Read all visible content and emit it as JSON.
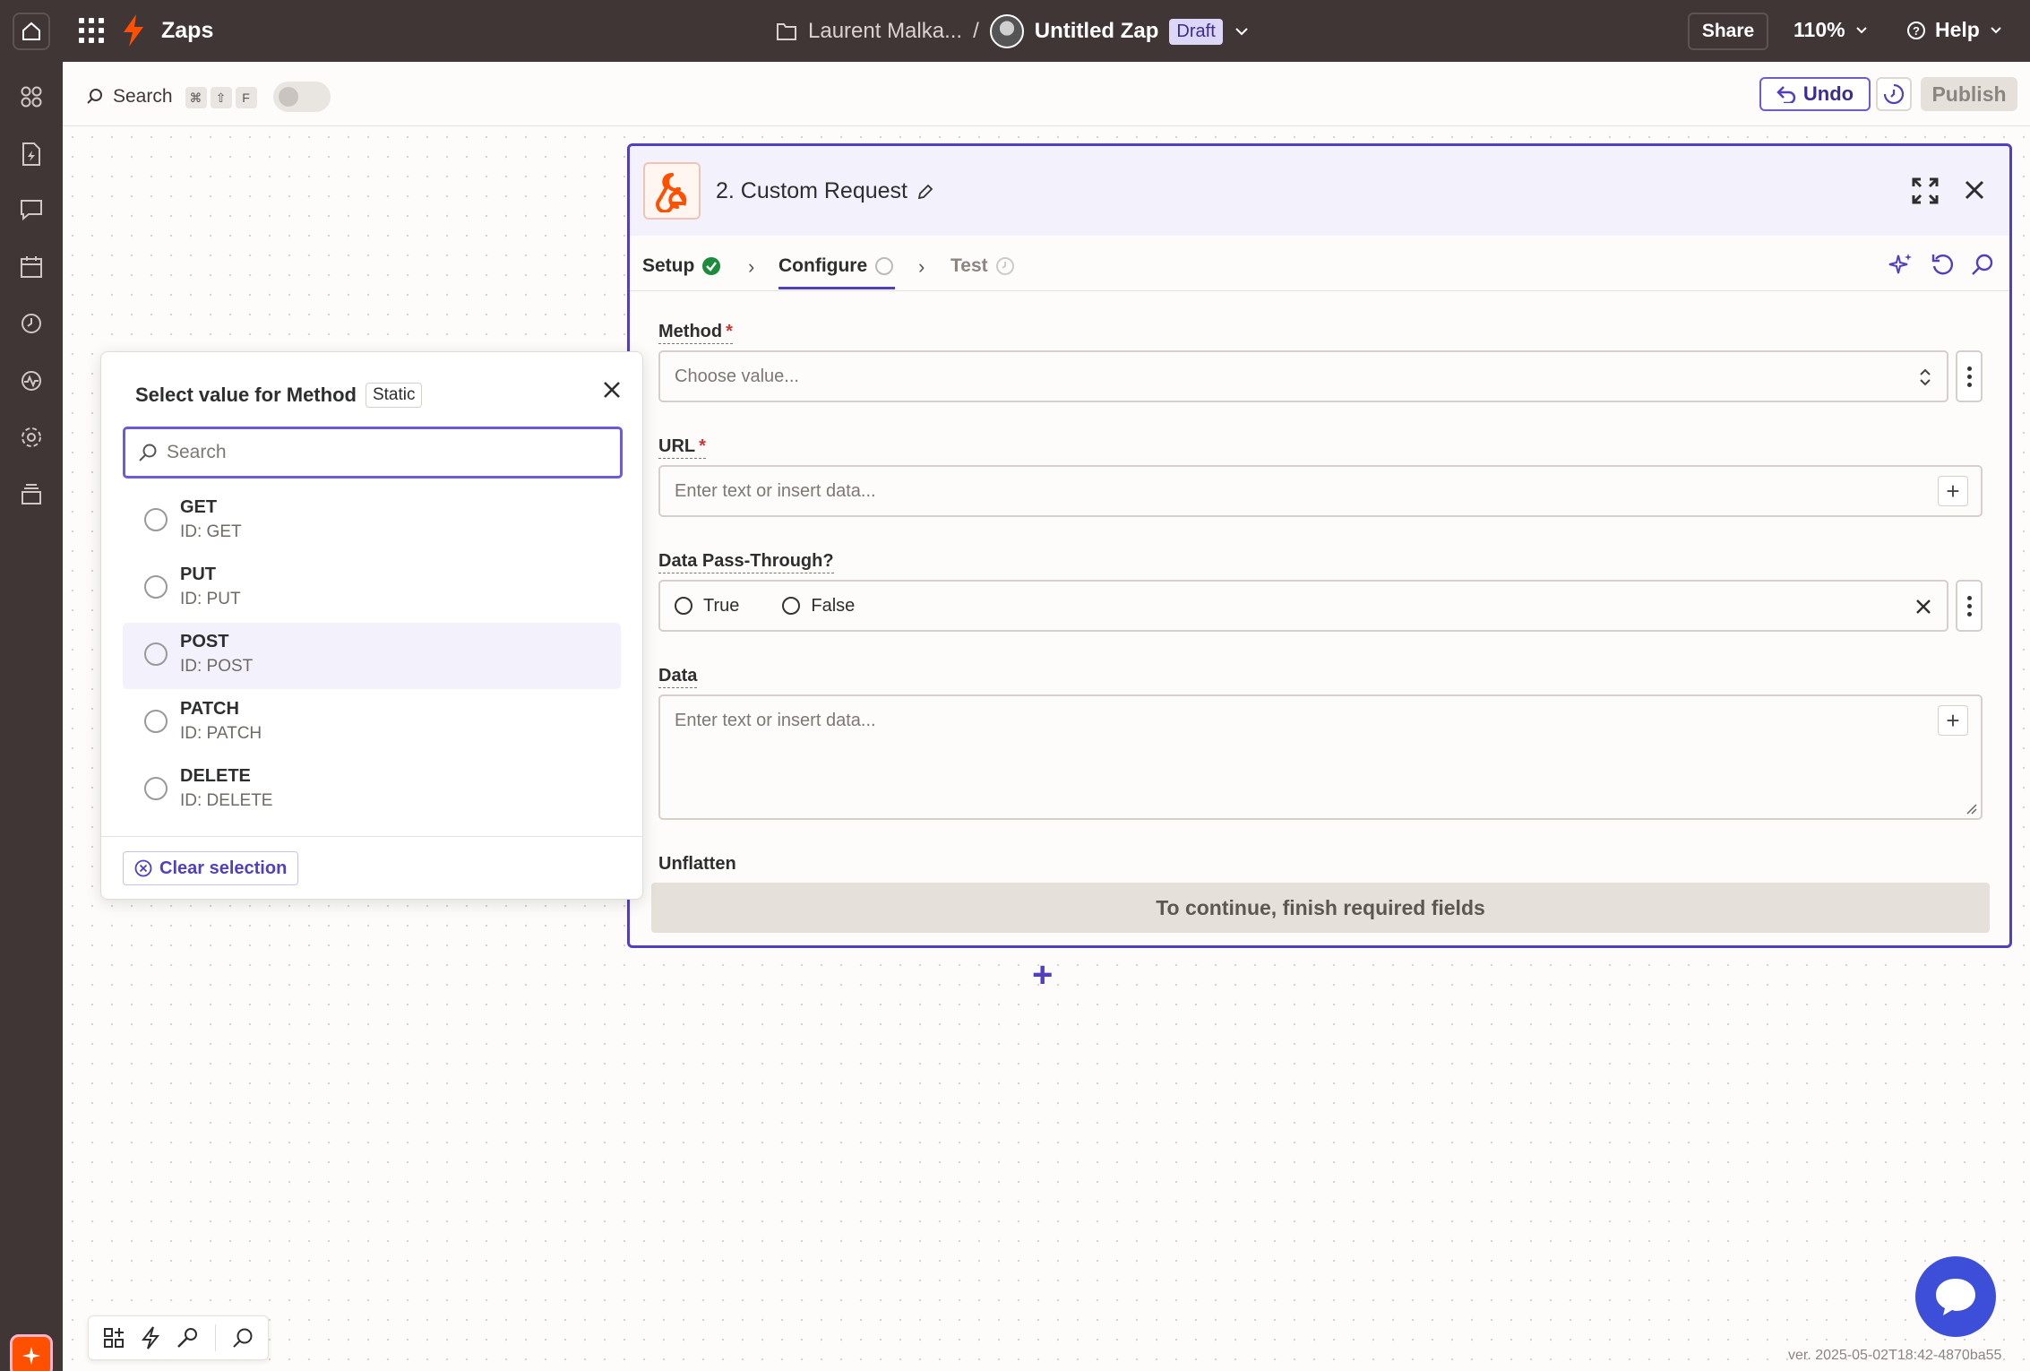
{
  "topbar": {
    "app_title": "Zaps",
    "folder": "Laurent Malka...",
    "separator": "/",
    "zap_name": "Untitled Zap",
    "status_badge": "Draft",
    "share_label": "Share",
    "zoom_level": "110%",
    "help_label": "Help"
  },
  "subbar": {
    "search_label": "Search",
    "shortcut_keys": [
      "⌘",
      "⇧",
      "F"
    ],
    "undo_label": "Undo",
    "publish_label": "Publish"
  },
  "panel": {
    "step_title": "2. Custom Request",
    "tabs": [
      {
        "label": "Setup",
        "state": "complete"
      },
      {
        "label": "Configure",
        "state": "active"
      },
      {
        "label": "Test",
        "state": "pending"
      }
    ],
    "fields": {
      "method": {
        "label": "Method",
        "required": "*",
        "placeholder": "Choose value..."
      },
      "url": {
        "label": "URL",
        "required": "*",
        "placeholder": "Enter text or insert data..."
      },
      "passthrough": {
        "label": "Data Pass-Through?",
        "option_true": "True",
        "option_false": "False"
      },
      "data": {
        "label": "Data",
        "placeholder": "Enter text or insert data..."
      },
      "unflatten": {
        "label": "Unflatten"
      }
    },
    "continue_label": "To continue, finish required fields"
  },
  "popover": {
    "title": "Select value for Method",
    "badge": "Static",
    "search_placeholder": "Search",
    "options": [
      {
        "name": "GET",
        "id": "ID: GET"
      },
      {
        "name": "PUT",
        "id": "ID: PUT"
      },
      {
        "name": "POST",
        "id": "ID: POST"
      },
      {
        "name": "PATCH",
        "id": "ID: PATCH"
      },
      {
        "name": "DELETE",
        "id": "ID: DELETE"
      }
    ],
    "clear_label": "Clear selection"
  },
  "version": "ver. 2025-05-02T18:42-4870ba55",
  "colors": {
    "brand_orange": "#ff4f00",
    "accent_purple": "#503fbf",
    "topbar_bg": "#403635",
    "success_green": "#1e8a3c"
  }
}
